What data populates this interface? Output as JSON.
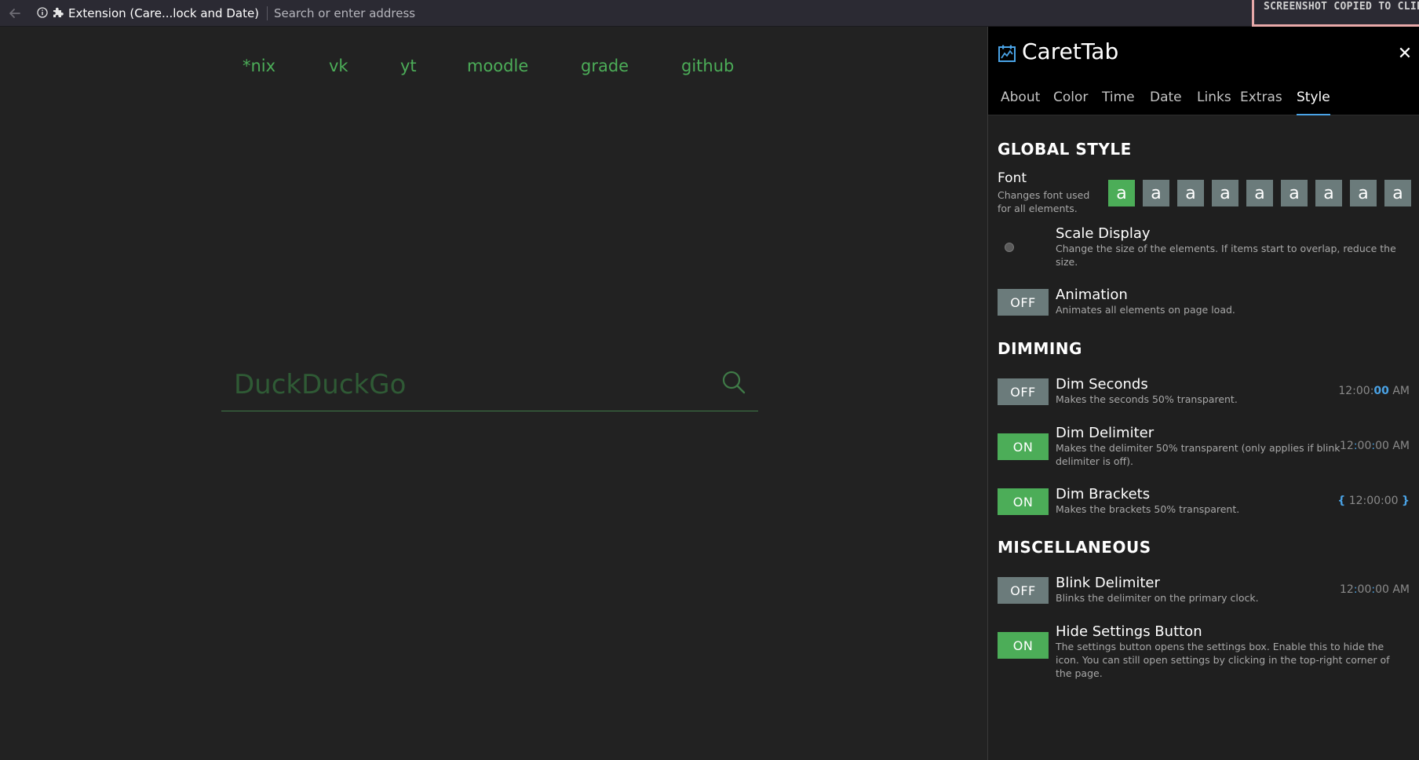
{
  "browser": {
    "tab_title": "Extension (Care...lock and Date)",
    "address_placeholder": "Search or enter address",
    "toast": "SCREENSHOT COPIED TO CLIPBO"
  },
  "newtab": {
    "links": [
      "*nix",
      "vk",
      "yt",
      "moodle",
      "grade",
      "github"
    ],
    "search_placeholder": "DuckDuckGo"
  },
  "panel": {
    "title": "CaretTab",
    "close": "✕",
    "tabs": [
      "About",
      "Color",
      "Time",
      "Date",
      "Links",
      "Extras",
      "Style"
    ],
    "active_tab": "Style",
    "global_style": {
      "heading": "GLOBAL STYLE",
      "font_label": "Font",
      "font_desc": "Changes font used for all elements.",
      "font_glyph": "a",
      "font_count": 9,
      "font_selected_index": 0,
      "scale_label": "Scale Display",
      "scale_desc": "Change the size of the elements. If items start to overlap, reduce the size.",
      "animation_label": "Animation",
      "animation_desc": "Animates all elements on page load.",
      "animation_state": "OFF"
    },
    "dimming": {
      "heading": "DIMMING",
      "dim_seconds_label": "Dim Seconds",
      "dim_seconds_desc": "Makes the seconds 50% transparent.",
      "dim_seconds_state": "OFF",
      "dim_seconds_preview": {
        "a": "12:00:",
        "b": "00",
        "c": " AM"
      },
      "dim_delimiter_label": "Dim Delimiter",
      "dim_delimiter_desc": "Makes the delimiter 50% transparent (only applies if blink delimiter is off).",
      "dim_delimiter_state": "ON",
      "dim_delimiter_preview": {
        "a": "12",
        "b": ":",
        "c": "00",
        "d": ":",
        "e": "00 AM"
      },
      "dim_brackets_label": "Dim Brackets",
      "dim_brackets_desc": "Makes the brackets 50% transparent.",
      "dim_brackets_state": "ON",
      "dim_brackets_preview": {
        "a": "{",
        "b": " 12:00:00 ",
        "c": "}"
      }
    },
    "misc": {
      "heading": "MISCELLANEOUS",
      "blink_label": "Blink Delimiter",
      "blink_desc": "Blinks the delimiter on the primary clock.",
      "blink_state": "OFF",
      "blink_preview": {
        "a": "12",
        "b": ":",
        "c": "00",
        "d": ":",
        "e": "00 AM"
      },
      "hide_label": "Hide Settings Button",
      "hide_desc": "The settings button opens the settings box. Enable this to hide the icon. You can still open settings by clicking in the top-right corner of the page.",
      "hide_state": "ON"
    }
  },
  "colors": {
    "accent_green": "#4cad58",
    "accent_blue": "#4aa3e6",
    "toggle_off": "#6b7b7b",
    "background": "#222222"
  }
}
